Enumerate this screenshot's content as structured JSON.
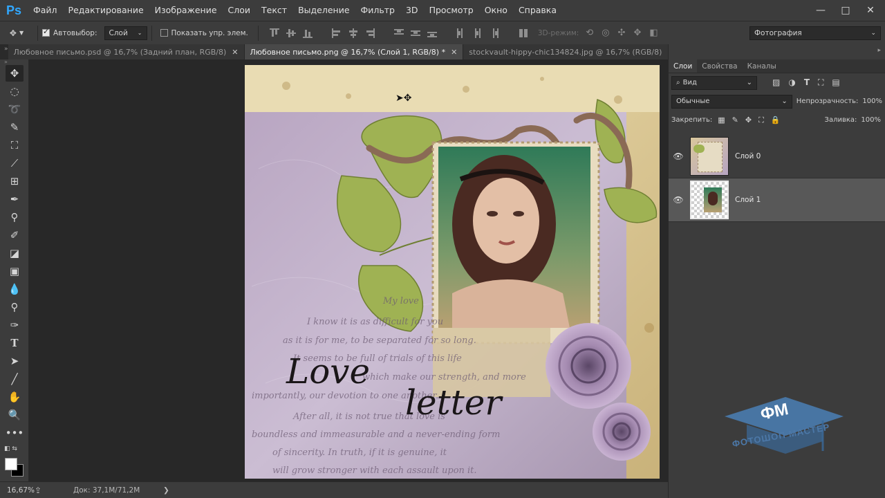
{
  "app": {
    "logo": "Ps"
  },
  "menu": [
    "Файл",
    "Редактирование",
    "Изображение",
    "Слои",
    "Текст",
    "Выделение",
    "Фильтр",
    "3D",
    "Просмотр",
    "Окно",
    "Справка"
  ],
  "window_controls": {
    "minimize": "—",
    "maximize": "□",
    "close": "✕"
  },
  "options": {
    "autoselect_label": "Автовыбор:",
    "autoselect_checked": true,
    "autoselect_target": "Слой",
    "show_transform_label": "Показать упр. элем.",
    "show_transform_checked": false,
    "mode_3d_label": "3D-режим:",
    "workspace": "Фотография"
  },
  "tabs": [
    {
      "title": "Любовное письмо.psd @ 16,7% (Задний план, RGB/8)",
      "active": false
    },
    {
      "title": "Любовное письмо.png @ 16,7% (Слой 1, RGB/8) *",
      "active": true
    },
    {
      "title": "stockvault-hippy-chic134824.jpg @ 16,7% (RGB/8)",
      "active": false
    }
  ],
  "status": {
    "zoom": "16,67%",
    "doc_info": "Док: 37,1M/71,2M",
    "more_arrow": "❯"
  },
  "panels": {
    "tabs": [
      "Слои",
      "Свойства",
      "Каналы"
    ],
    "active_tab": "Слои",
    "filter_kind": "Вид",
    "blend_mode": "Обычные",
    "opacity_label": "Непрозрачность:",
    "opacity_value": "100%",
    "lock_label": "Закрепить:",
    "fill_label": "Заливка:",
    "fill_value": "100%",
    "layers": [
      {
        "name": "Слой 0",
        "visible": true,
        "selected": false
      },
      {
        "name": "Слой 1",
        "visible": true,
        "selected": true
      }
    ]
  },
  "canvas": {
    "script_text_1": "Love",
    "script_text_2": "letter",
    "background_lines": [
      "My love",
      "I know it is as difficult for you",
      "as it is for me, to be separated for so long.",
      "It seems to be full of trials of this life",
      "which make our strength, and more",
      "importantly, our devotion to one another.",
      "After all, it is not true that love is",
      "boundless and immeasurable and a never-ending form",
      "of sincerity. In truth, if it is genuine, it",
      "will grow stronger with each assault upon it."
    ]
  },
  "watermark": {
    "logo": "ФМ",
    "text": "ФОТОШОП МАСТЕР"
  },
  "colors": {
    "ps_blue": "#31a8ff",
    "panel_bg": "#3c3c3c",
    "workspace_bg": "#282828",
    "watermark_blue": "#4a7fb5"
  }
}
